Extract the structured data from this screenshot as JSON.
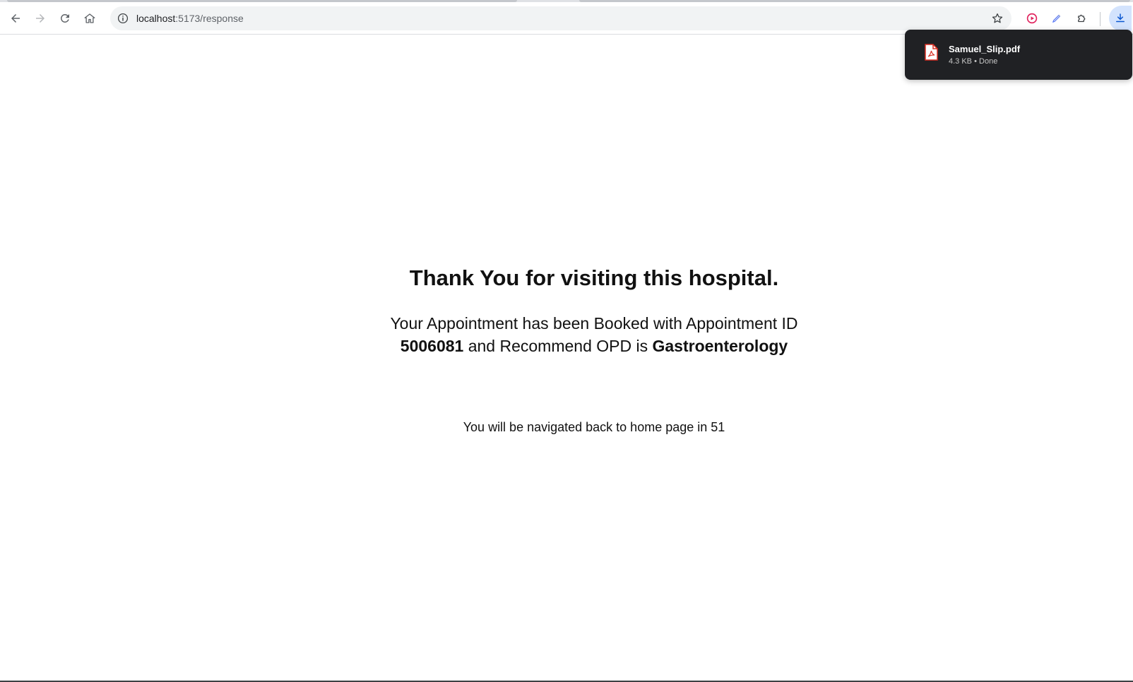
{
  "browser": {
    "url_host": "localhost",
    "url_path": ":5173/response",
    "buttons": {
      "back": "back-arrow-icon",
      "forward": "forward-arrow-icon",
      "reload": "reload-icon",
      "home": "home-icon"
    },
    "extensions": [
      "record-icon",
      "pen-icon",
      "puzzle-icon"
    ]
  },
  "download": {
    "filename": "Samuel_Slip.pdf",
    "size": "4.3 KB",
    "status": "Done",
    "separator": "•",
    "icon": "pdf-file-icon"
  },
  "page": {
    "title": "Thank You for visiting this hospital.",
    "message_prefix": "Your Appointment has been Booked with Appointment ID",
    "appointment_id": "5006081",
    "message_middle": "and Recommend OPD is",
    "opd": "Gastroenterology",
    "countdown_text": "You will be navigated back to home page in",
    "countdown_seconds": "51"
  },
  "colors": {
    "bubble_bg": "#202124",
    "pdf_red": "#d93025",
    "record_red": "#e0245e",
    "download_active": "#d3e3fd"
  }
}
